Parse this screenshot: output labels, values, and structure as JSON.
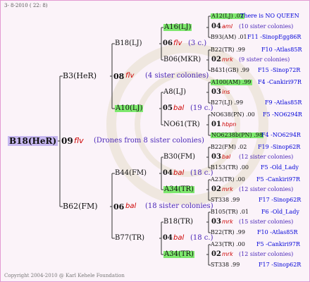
{
  "header": {
    "date": "3-  8-2010 ( 22:  8)"
  },
  "footer": "Copyright 2004-2010 @ Karl Kehele Foundation",
  "colors": {
    "year_color": "#cc0000",
    "green_highlight": "#7ee86e",
    "note_color": "#4a26b8",
    "link_color": "#0000d8",
    "border": "#e29ad2"
  },
  "root": {
    "name": "B18(HeR)",
    "year": "09",
    "code": "flv",
    "note": "(Drones from 8 sister colonies)",
    "parents": [
      {
        "name": "B3(HeR)",
        "year": "08",
        "code": "flv",
        "note": "(4 sister colonies)",
        "parents": [
          {
            "name": "B18(LJ)",
            "year": "06",
            "code": "flv",
            "note": "(3 c.)",
            "parents": [
              "A16(LJ)",
              "B06(MKR)"
            ]
          },
          {
            "name": "A10(LJ)",
            "year": "05",
            "code": "bal",
            "note": "(19 c.)",
            "parents": [
              "A8(LJ)",
              "NO61(TR)"
            ]
          }
        ]
      },
      {
        "name": "B62(FM)",
        "year": "06",
        "code": "bal",
        "note": "(18 sister colonies)",
        "parents": [
          {
            "name": "B44(FM)",
            "year": "04",
            "code": "bal",
            "note": "(18 c.)",
            "parents": [
              "B30(FM)",
              "A34(TR)"
            ]
          },
          {
            "name": "B77(TR)",
            "year": "04",
            "code": "bal",
            "note": "(18 c.)",
            "parents": [
              "B18(TR)",
              "A34(TR)"
            ]
          }
        ]
      }
    ]
  },
  "right_column": [
    {
      "top": "A12(LJ) .02",
      "extra": "There is NO QUEEN",
      "year": "04",
      "code": "aml",
      "note": "(10 sister colonies)",
      "bottom": "B93(AM) .01",
      "bottom_link": "F11 -SinopEgg86R"
    },
    {
      "top": "B22(TR) .99",
      "top_link": "F10 -Atlas85R",
      "year": "02",
      "code": "mrk",
      "note": "(9 sister colonies)",
      "bottom": "B431(GB) .99",
      "bottom_link": "F15 -Sinop72R"
    },
    {
      "top": "A100(AM) .99",
      "top_link": "F4 -Cankiri97R",
      "year": "03",
      "code": "ins",
      "note": "",
      "bottom": "B27(LJ) .99",
      "bottom_link": "F9 -Atlas85R"
    },
    {
      "top": "NO638(PN) .00",
      "top_link": "F5 -NO6294R",
      "year": "01",
      "code": "hbpn",
      "note": "",
      "bottom": "NO6238b(PN) .98",
      "bottom_link": "F4 -NO6294R"
    },
    {
      "top": "B22(FM) .02",
      "top_link": "F19 -Sinop62R",
      "year": "03",
      "code": "bal",
      "note": "(12 sister colonies)",
      "bottom": "B153(TR) .00",
      "bottom_link": "F5 -Old_Lady"
    },
    {
      "top": "A23(TR) .00",
      "top_link": "F5 -Cankiri97R",
      "year": "02",
      "code": "mrk",
      "note": "(12 sister colonies)",
      "bottom": "ST338 .99",
      "bottom_link": "F17 -Sinop62R"
    },
    {
      "top": "B105(TR) .01",
      "top_link": "F6 -Old_Lady",
      "year": "03",
      "code": "mrk",
      "note": "(15 sister colonies)",
      "bottom": "B22(TR) .99",
      "bottom_link": "F10 -Atlas85R"
    },
    {
      "top": "A23(TR) .00",
      "top_link": "F5 -Cankiri97R",
      "year": "02",
      "code": "mrk",
      "note": "(12 sister colonies)",
      "bottom": "ST338 .99",
      "bottom_link": "F17 -Sinop62R"
    }
  ]
}
